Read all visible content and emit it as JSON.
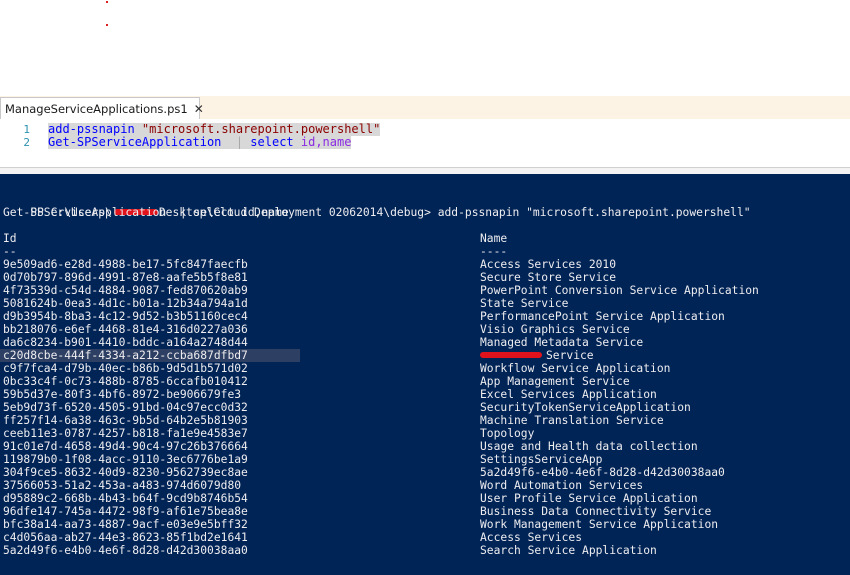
{
  "tab": {
    "label": "ManageServiceApplications.ps1",
    "close": "✕"
  },
  "editor": {
    "lines": [
      {
        "num": "1",
        "parts": [
          {
            "cls": "kw",
            "text": "add-pssnapin "
          },
          {
            "cls": "str",
            "text": "\"microsoft.sharepoint.powershell\""
          }
        ]
      },
      {
        "num": "2",
        "parts": [
          {
            "cls": "kw",
            "text": "Get-SPServiceApplication"
          },
          {
            "cls": "pipe",
            "text": "  | "
          },
          {
            "cls": "kw",
            "text": "select "
          },
          {
            "cls": "prm",
            "text": "id,name"
          }
        ]
      }
    ]
  },
  "console": {
    "prompt_before": "PS C:\\Users\\",
    "prompt_after": "Desktop\\Cloud Deployment 02062014\\debug> add-pssnapin \"microsoft.sharepoint.powershell\"",
    "command2": "Get-SPServiceApplication  | select id,name",
    "header_id": "Id",
    "header_name": "Name",
    "underline_id": "--",
    "underline_name": "----",
    "rows": [
      {
        "id": "9e509ad6-e28d-4988-be17-5fc847faecfb",
        "name": "Access Services 2010"
      },
      {
        "id": "0d70b797-896d-4991-87e8-aafe5b5f8e81",
        "name": "Secure Store Service"
      },
      {
        "id": "4f73539d-c54d-4884-9087-fed870620ab9",
        "name": "PowerPoint Conversion Service Application"
      },
      {
        "id": "5081624b-0ea3-4d1c-b01a-12b34a794a1d",
        "name": "State Service"
      },
      {
        "id": "d9b3954b-8ba3-4c12-9d52-b3b51160cec4",
        "name": "PerformancePoint Service Application"
      },
      {
        "id": "bb218076-e6ef-4468-81e4-316d0227a036",
        "name": "Visio Graphics Service"
      },
      {
        "id": "da6c8234-b901-4410-bddc-a164a2748d44",
        "name": "Managed Metadata Service"
      },
      {
        "id": "c20d8cbe-444f-4334-a212-ccba687dfbd7",
        "name": "Service"
      },
      {
        "id": "c9f7fca4-d79b-40ec-b86b-9d5d1b571d02",
        "name": "Workflow Service Application"
      },
      {
        "id": "0bc33c4f-0c73-488b-8785-6ccafb010412",
        "name": "App Management Service"
      },
      {
        "id": "59b5d37e-80f3-4bf6-8972-be906679fe3",
        "name": "Excel Services Application"
      },
      {
        "id": "5eb9d73f-6520-4505-91bd-04c97ecc0d32",
        "name": "SecurityTokenServiceApplication"
      },
      {
        "id": "ff257f14-6a38-463c-9b5d-64b2e5b81903",
        "name": "Machine Translation Service"
      },
      {
        "id": "ceeb11e3-0787-4257-b818-fa1e9e4583e7",
        "name": "Topology"
      },
      {
        "id": "91c01e7d-4658-49d4-90c4-97c26b376664",
        "name": "Usage and Health data collection"
      },
      {
        "id": "119879b0-1f08-4acc-9110-3ec6776be1a9",
        "name": "SettingsServiceApp"
      },
      {
        "id": "304f9ce5-8632-40d9-8230-9562739ec8ae",
        "name": "5a2d49f6-e4b0-4e6f-8d28-d42d30038aa0"
      },
      {
        "id": "37566053-51a2-453a-a483-974d6079d80",
        "name": "Word Automation Services"
      },
      {
        "id": "d95889c2-668b-4b43-b64f-9cd9b8746b54",
        "name": "User Profile Service Application"
      },
      {
        "id": "96dfe147-745a-4472-98f9-af61e75bea8e",
        "name": "Business Data Connectivity Service"
      },
      {
        "id": "bfc38a14-aa73-4887-9acf-e03e9e5bff32",
        "name": "Work Management Service Application"
      },
      {
        "id": "c4d056aa-ab27-44e3-8623-85f1bd2e1641",
        "name": "Access Services"
      },
      {
        "id": "5a2d49f6-e4b0-4e6f-8d28-d42d30038aa0",
        "name": "Search Service Application"
      }
    ]
  }
}
